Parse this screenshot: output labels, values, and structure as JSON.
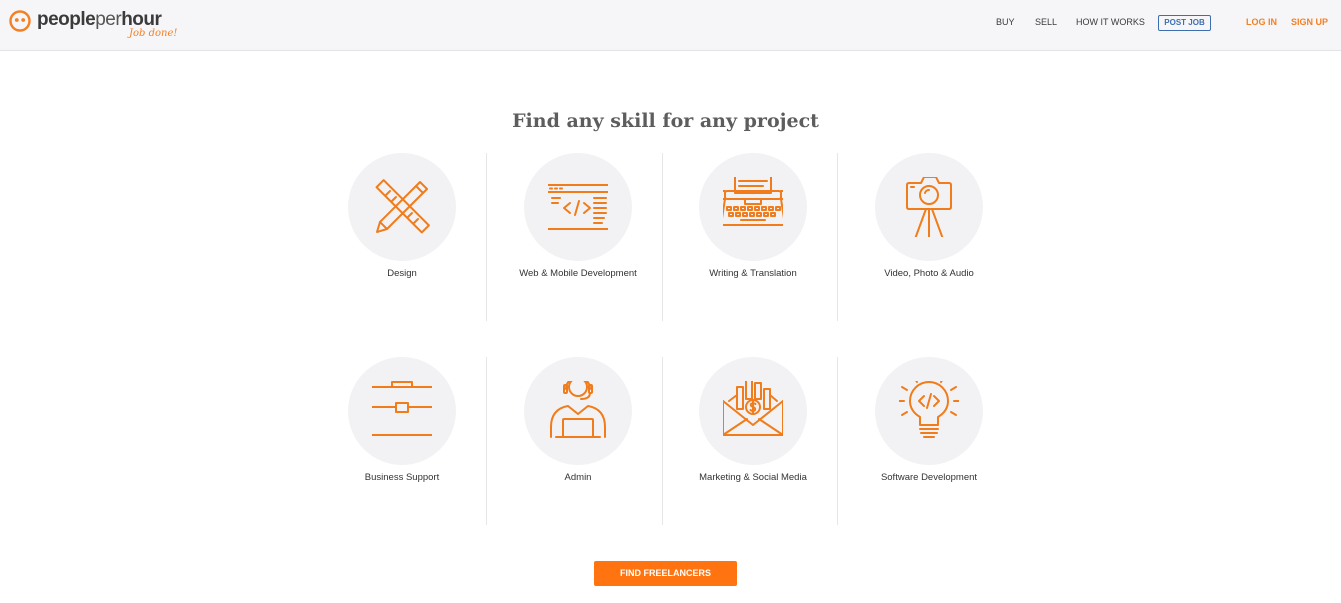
{
  "brand": {
    "name_bold_1": "people",
    "name_light": "per",
    "name_bold_2": "hour",
    "tagline": "Job done!",
    "accent_color": "#f48024",
    "icon": "smiley-face-icon"
  },
  "nav": {
    "buy": "BUY",
    "sell": "SELL",
    "how_it_works": "HOW IT WORKS",
    "post_job": "POST JOB",
    "log_in": "LOG IN",
    "sign_up": "SIGN UP"
  },
  "main": {
    "headline": "Find any skill for any project",
    "categories": [
      {
        "label": "Design",
        "icon": "pencil-ruler-icon"
      },
      {
        "label": "Web & Mobile Development",
        "icon": "code-window-icon"
      },
      {
        "label": "Writing & Translation",
        "icon": "typewriter-icon"
      },
      {
        "label": "Video, Photo & Audio",
        "icon": "camera-tripod-icon"
      },
      {
        "label": "Business Support",
        "icon": "briefcase-icon"
      },
      {
        "label": "Admin",
        "icon": "headset-operator-icon"
      },
      {
        "label": "Marketing & Social Media",
        "icon": "envelope-chart-icon"
      },
      {
        "label": "Software Development",
        "icon": "lightbulb-code-icon"
      }
    ],
    "cta": "FIND FREELANCERS"
  },
  "colors": {
    "accent": "#f48024",
    "button": "#ff7410",
    "link_blue": "#3d6fb0",
    "circle_bg": "#f2f2f4"
  }
}
